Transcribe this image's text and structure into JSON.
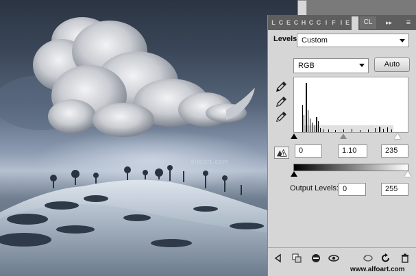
{
  "canvas": {
    "watermark": "alfoart.com"
  },
  "panel": {
    "tabs": [
      "L",
      "C",
      "E",
      "C",
      "H",
      "C",
      "C",
      "I",
      "F",
      "I",
      "E"
    ],
    "tab_collapsed_label": "CL",
    "tab_arrows": "▸▸",
    "tab_menu": "≡",
    "title": "Levels",
    "preset": "Custom",
    "channel": "RGB",
    "auto_label": "Auto",
    "input_black": "0",
    "input_gamma": "1.10",
    "input_white": "235",
    "output_label": "Output Levels:",
    "output_black": "0",
    "output_white": "255",
    "site_url": "www.alfoart.com"
  },
  "icons": [
    "black-eyedropper-icon",
    "gray-eyedropper-icon",
    "white-eyedropper-icon",
    "clipping-warning-icon",
    "return-arrow-icon",
    "clip-to-layer-icon",
    "visibility-mask-icon",
    "eye-icon",
    "view-previous-icon",
    "reset-icon",
    "trash-icon"
  ],
  "colors": {
    "panel_bg": "#d6d6d6",
    "tab_bar": "#5e5e5e",
    "sky_dark": "#2b3442",
    "snow_light": "#c9d3de"
  }
}
